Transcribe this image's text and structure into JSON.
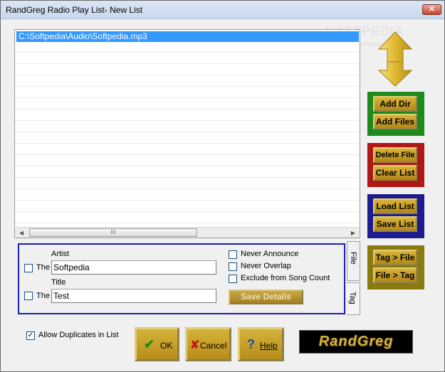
{
  "window": {
    "title": "RandGreg Radio Play List- New List"
  },
  "watermark": {
    "brand": "SOFTPEDIA",
    "url": "www.softpedia.com"
  },
  "playlist": {
    "items": [
      {
        "path": "C:\\Softpedia\\Audio\\Softpedia.mp3",
        "selected": true
      }
    ],
    "scroll_grip": "III"
  },
  "side_buttons": {
    "add_dir": "Add Dir",
    "add_files": "Add Files",
    "delete_file": "Delete File",
    "clear_list": "Clear List",
    "load_list": "Load List",
    "save_list": "Save List",
    "tag_to_file": "Tag > File",
    "file_to_tag": "File > Tag"
  },
  "panel_colors": {
    "green": "#1d8a1d",
    "red": "#b01818",
    "blue": "#1c1c8e",
    "olive": "#8a7a10"
  },
  "details": {
    "artist_label": "Artist",
    "artist_the": "The",
    "artist_value": "Softpedia",
    "title_label": "Title",
    "title_the": "The",
    "title_value": "Test",
    "never_announce": "Never Announce",
    "never_overlap": "Never Overlap",
    "exclude_count": "Exclude from Song Count",
    "save_details": "Save Details"
  },
  "tabs": {
    "file": "File",
    "tag": "Tag"
  },
  "bottom": {
    "allow_duplicates": "Allow Duplicates in List",
    "allow_duplicates_checked": true,
    "ok": "OK",
    "cancel": "Cancel",
    "help": "Help",
    "logo": "RandGreg"
  }
}
